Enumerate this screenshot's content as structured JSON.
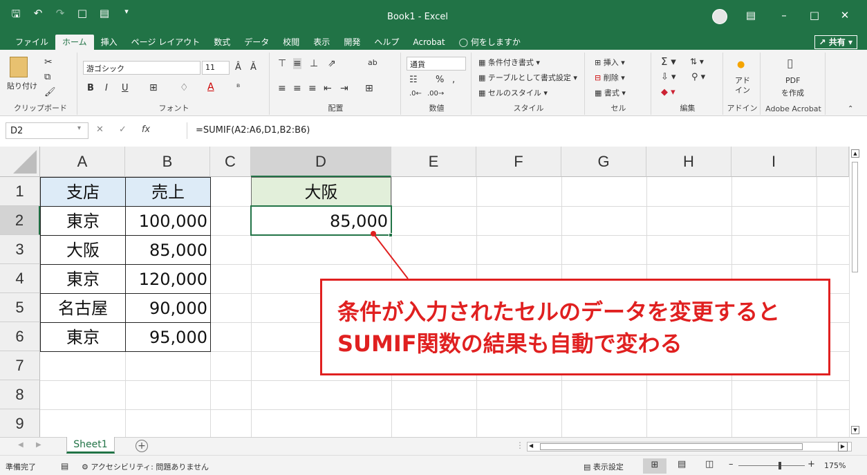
{
  "window": {
    "title": "Book1  -  Excel",
    "share_label": "共有"
  },
  "menu": {
    "tabs": [
      "ファイル",
      "ホーム",
      "挿入",
      "ページ レイアウト",
      "数式",
      "データ",
      "校閲",
      "表示",
      "開発",
      "ヘルプ",
      "Acrobat"
    ],
    "search": "何をしますか"
  },
  "ribbon": {
    "clipboard": {
      "paste": "貼り付け",
      "label": "クリップボード"
    },
    "font": {
      "name": "游ゴシック",
      "size": "11",
      "label": "フォント"
    },
    "alignment": {
      "label": "配置"
    },
    "number": {
      "format": "通貨",
      "label": "数値"
    },
    "styles": {
      "conditional": "条件付き書式",
      "table": "テーブルとして書式設定",
      "cell_styles": "セルのスタイル",
      "label": "スタイル"
    },
    "cells": {
      "insert": "挿入",
      "delete": "削除",
      "format": "書式",
      "label": "セル"
    },
    "editing": {
      "label": "編集"
    },
    "addins": {
      "btn": "アド\nイン",
      "label": "アドイン"
    },
    "acrobat": {
      "btn1": "PDF",
      "btn2": "を作成",
      "label": "Adobe Acrobat"
    }
  },
  "formula_bar": {
    "name_box": "D2",
    "formula": "=SUMIF(A2:A6,D1,B2:B6)"
  },
  "columns": [
    "A",
    "B",
    "C",
    "D",
    "E",
    "F",
    "G",
    "H",
    "I"
  ],
  "rows": [
    "1",
    "2",
    "3",
    "4",
    "5",
    "6",
    "7",
    "8",
    "9"
  ],
  "table": {
    "headers": {
      "a": "支店",
      "b": "売上"
    },
    "data": [
      {
        "a": "東京",
        "b": "100,000"
      },
      {
        "a": "大阪",
        "b": "85,000"
      },
      {
        "a": "東京",
        "b": "120,000"
      },
      {
        "a": "名古屋",
        "b": "90,000"
      },
      {
        "a": "東京",
        "b": "95,000"
      }
    ],
    "criteria_label": "大阪",
    "result": "85,000"
  },
  "callout": {
    "line1": "条件が入力されたセルのデータを変更すると",
    "line2": "SUMIF関数の結果も自動で変わる"
  },
  "sheets": {
    "active": "Sheet1"
  },
  "status": {
    "ready": "準備完了",
    "accessibility": "アクセシビリティ: 問題ありません",
    "display_settings": "表示設定",
    "zoom": "175%"
  }
}
